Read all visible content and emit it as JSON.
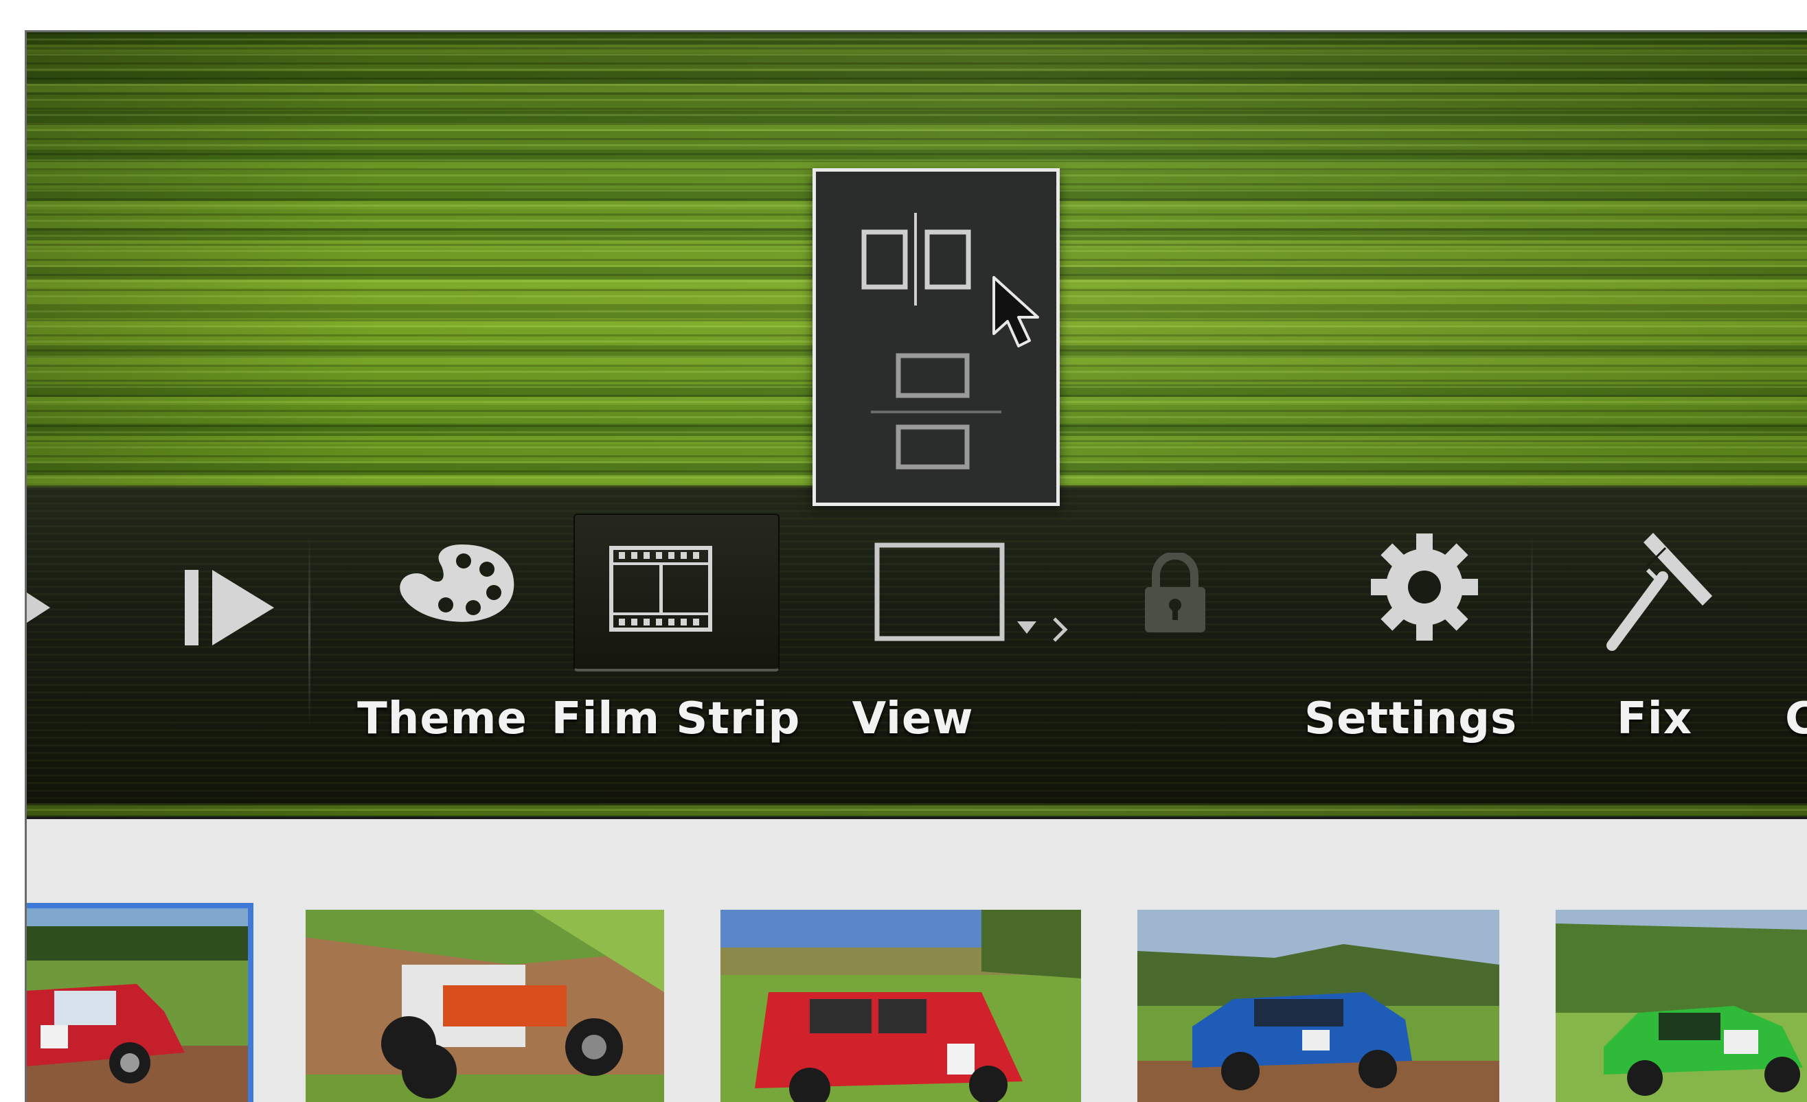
{
  "toolbar": {
    "items": [
      {
        "label": "Theme",
        "icon": "palette-icon"
      },
      {
        "label": "Film Strip",
        "icon": "film-strip-icon",
        "selected": true
      },
      {
        "label": "View",
        "icon": "view-icon"
      },
      {
        "label": "",
        "icon": "lock-icon",
        "disabled": true
      },
      {
        "label": "Settings",
        "icon": "gear-icon"
      },
      {
        "label": "Fix",
        "icon": "wiper-icon"
      },
      {
        "label": "C",
        "icon": ""
      }
    ]
  },
  "view_popup": {
    "options": [
      {
        "name": "side-by-side",
        "icon": "side-by-side-layout-icon",
        "hovered": true
      },
      {
        "name": "stacked",
        "icon": "stacked-layout-icon"
      }
    ]
  },
  "gallery": {
    "thumbnails": [
      {
        "subject": "red hatchback",
        "selected": true
      },
      {
        "subject": "buggy"
      },
      {
        "subject": "red mini"
      },
      {
        "subject": "blue hatchback"
      },
      {
        "subject": "green hatchback"
      }
    ]
  },
  "colors": {
    "selection_border": "#3f7ad8",
    "popup_bg": "#2b2c2c",
    "toolbar_bg": "#181c12"
  }
}
